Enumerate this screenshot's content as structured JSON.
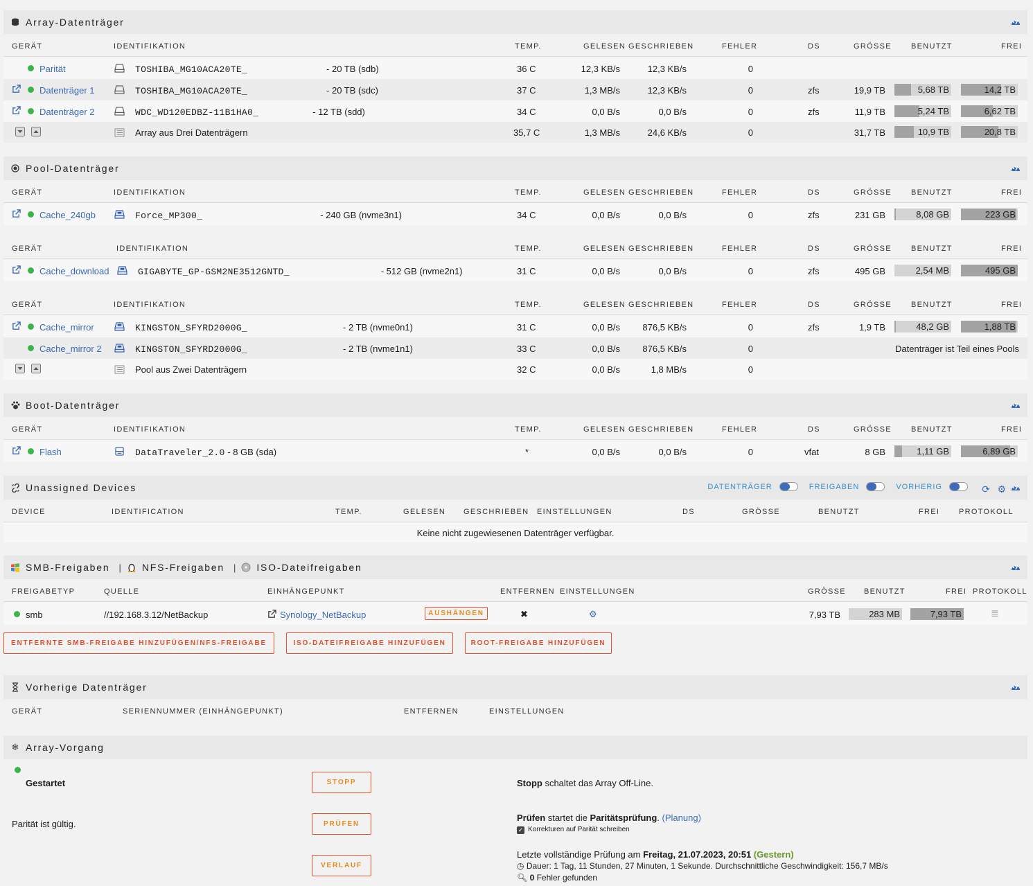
{
  "array": {
    "title": "Array-Datenträger",
    "headers": {
      "device": "GERÄT",
      "ident": "IDENTIFIKATION",
      "temp": "TEMP.",
      "read": "GELESEN",
      "write": "GESCHRIEBEN",
      "errors": "FEHLER",
      "fs": "DS",
      "size": "GRÖSSE",
      "used": "BENUTZT",
      "free": "FREI"
    },
    "rows": [
      {
        "name": "Parität",
        "id_mono": "TOSHIBA_MG10ACA20TE_",
        "id_size": "- 20 TB (sdb)",
        "temp": "36 C",
        "read": "12,3 KB/s",
        "write": "12,3 KB/s",
        "errors": "0",
        "fs": "",
        "size": "",
        "used": "",
        "free": ""
      },
      {
        "name": "Datenträger 1",
        "id_mono": "TOSHIBA_MG10ACA20TE_",
        "id_size": "- 20 TB (sdc)",
        "temp": "37 C",
        "read": "1,3 MB/s",
        "write": "12,3 KB/s",
        "errors": "0",
        "fs": "zfs",
        "size": "19,9 TB",
        "used": "5,68 TB",
        "free": "14,2 TB"
      },
      {
        "name": "Datenträger 2",
        "id_mono": "WDC_WD120EDBZ-11B1HA0_",
        "id_size": "- 12 TB (sdd)",
        "temp": "34 C",
        "read": "0,0 B/s",
        "write": "0,0 B/s",
        "errors": "0",
        "fs": "zfs",
        "size": "11,9 TB",
        "used": "5,24 TB",
        "free": "6,62 TB"
      }
    ],
    "summary": {
      "label": "Array aus Drei Datenträgern",
      "temp": "35,7 C",
      "read": "1,3 MB/s",
      "write": "24,6 KB/s",
      "errors": "0",
      "size": "31,7 TB",
      "used": "10,9 TB",
      "free": "20,8 TB"
    }
  },
  "pool": {
    "title": "Pool-Datenträger",
    "cache240": {
      "name": "Cache_240gb",
      "id_mono": "Force_MP300_",
      "id_size": "- 240 GB (nvme3n1)",
      "temp": "34 C",
      "read": "0,0 B/s",
      "write": "0,0 B/s",
      "errors": "0",
      "fs": "zfs",
      "size": "231 GB",
      "used": "8,08 GB",
      "free": "223 GB"
    },
    "download": {
      "name": "Cache_download",
      "id_mono": "GIGABYTE_GP-GSM2NE3512GNTD_",
      "id_size": "- 512 GB (nvme2n1)",
      "temp": "31 C",
      "read": "0,0 B/s",
      "write": "0,0 B/s",
      "errors": "0",
      "fs": "zfs",
      "size": "495 GB",
      "used": "2,54 MB",
      "free": "495 GB"
    },
    "mirror1": {
      "name": "Cache_mirror",
      "id_mono": "KINGSTON_SFYRD2000G_",
      "id_size": "- 2 TB (nvme0n1)",
      "temp": "31 C",
      "read": "0,0 B/s",
      "write": "876,5 KB/s",
      "errors": "0",
      "fs": "zfs",
      "size": "1,9 TB",
      "used": "48,2 GB",
      "free": "1,88 TB"
    },
    "mirror2": {
      "name": "Cache_mirror 2",
      "id_mono": "KINGSTON_SFYRD2000G_",
      "id_size": "- 2 TB (nvme1n1)",
      "temp": "33 C",
      "read": "0,0 B/s",
      "write": "876,5 KB/s",
      "errors": "0",
      "note": "Datenträger ist Teil eines Pools"
    },
    "summary": {
      "label": "Pool aus Zwei Datenträgern",
      "temp": "32 C",
      "read": "0,0 B/s",
      "write": "1,8 MB/s",
      "errors": "0"
    }
  },
  "boot": {
    "title": "Boot-Datenträger",
    "flash": {
      "name": "Flash",
      "id_mono": "DataTraveler_2.0",
      "id_size": "- 8 GB (sda)",
      "temp": "*",
      "read": "0,0 B/s",
      "write": "0,0 B/s",
      "errors": "0",
      "fs": "vfat",
      "size": "8 GB",
      "used": "1,11 GB",
      "free": "6,89 GB"
    }
  },
  "unassigned": {
    "title": "Unassigned Devices",
    "toggles": [
      "DATENTRÄGER",
      "FREIGABEN",
      "VORHERIG"
    ],
    "headers": {
      "device": "DEVICE",
      "ident": "IDENTIFICATION",
      "temp": "TEMP.",
      "read": "GELESEN",
      "write": "GESCHRIEBEN",
      "settings": "EINSTELLUNGEN",
      "fs": "DS",
      "size": "GRÖSSE",
      "used": "BENUTZT",
      "free": "FREI",
      "log": "PROTOKOLL"
    },
    "empty": "Keine nicht zugewiesenen Datenträger verfügbar."
  },
  "shares": {
    "smb_title": "SMB-Freigaben",
    "nfs_title": "NFS-Freigaben",
    "iso_title": "ISO-Dateifreigaben",
    "sep": "|",
    "headers": {
      "type": "FREIGABETYP",
      "source": "QUELLE",
      "mount": "EINHÄNGEPUNKT",
      "remove": "ENTFERNEN",
      "settings": "EINSTELLUNGEN",
      "size": "GRÖSSE",
      "used": "BENUTZT",
      "free": "FREI",
      "log": "PROTOKOLL"
    },
    "row": {
      "type": "smb",
      "source": "//192.168.3.12/NetBackup",
      "mount": "Synology_NetBackup",
      "unmount": "AUSHÄNGEN",
      "remove": "✖",
      "size": "7,93 TB",
      "used": "283 MB",
      "free": "7,93 TB"
    },
    "buttons": [
      "ENTFERNTE SMB-FREIGABE HINZUFÜGEN/NFS-FREIGABE",
      "ISO-DATEIFREIGABE HINZUFÜGEN",
      "ROOT-FREIGABE HINZUFÜGEN"
    ]
  },
  "previous": {
    "title": "Vorherige Datenträger",
    "headers": {
      "device": "GERÄT",
      "serial": "SERIENNUMMER (EINHÄNGEPUNKT)",
      "remove": "ENTFERNEN",
      "settings": "EINSTELLUNGEN"
    }
  },
  "operation": {
    "title": "Array-Vorgang",
    "status": "Gestartet",
    "stop_btn": "STOPP",
    "stop_bold": "Stopp",
    "stop_desc": " schaltet das Array Off-Line.",
    "parity_status": "Parität ist gültig.",
    "check_btn": "PRÜFEN",
    "check_bold": "Prüfen",
    "check_mid": " startet die ",
    "check_bold2": "Paritätsprüfung",
    "check_end": ".",
    "planning": "(Planung)",
    "checkbox_label": "Korrekturen auf Parität schreiben",
    "history_btn": "VERLAUF",
    "last_check_prefix": "Letzte vollständige Prüfung am ",
    "last_check_date": "Freitag, 21.07.2023, 20:51",
    "last_check_rel": "(Gestern)",
    "duration": "Dauer: 1 Tag, 11 Stunden, 27 Minuten, 1 Sekunde. Durchschnittliche Geschwindigkeit: 156,7 MB/s",
    "errors_count": "0",
    "errors_label": " Fehler gefunden"
  },
  "colors": {
    "link": "#3a6ab7",
    "ok": "#3bb54a",
    "button": "#e2502b",
    "good": "#6a9a2a"
  }
}
